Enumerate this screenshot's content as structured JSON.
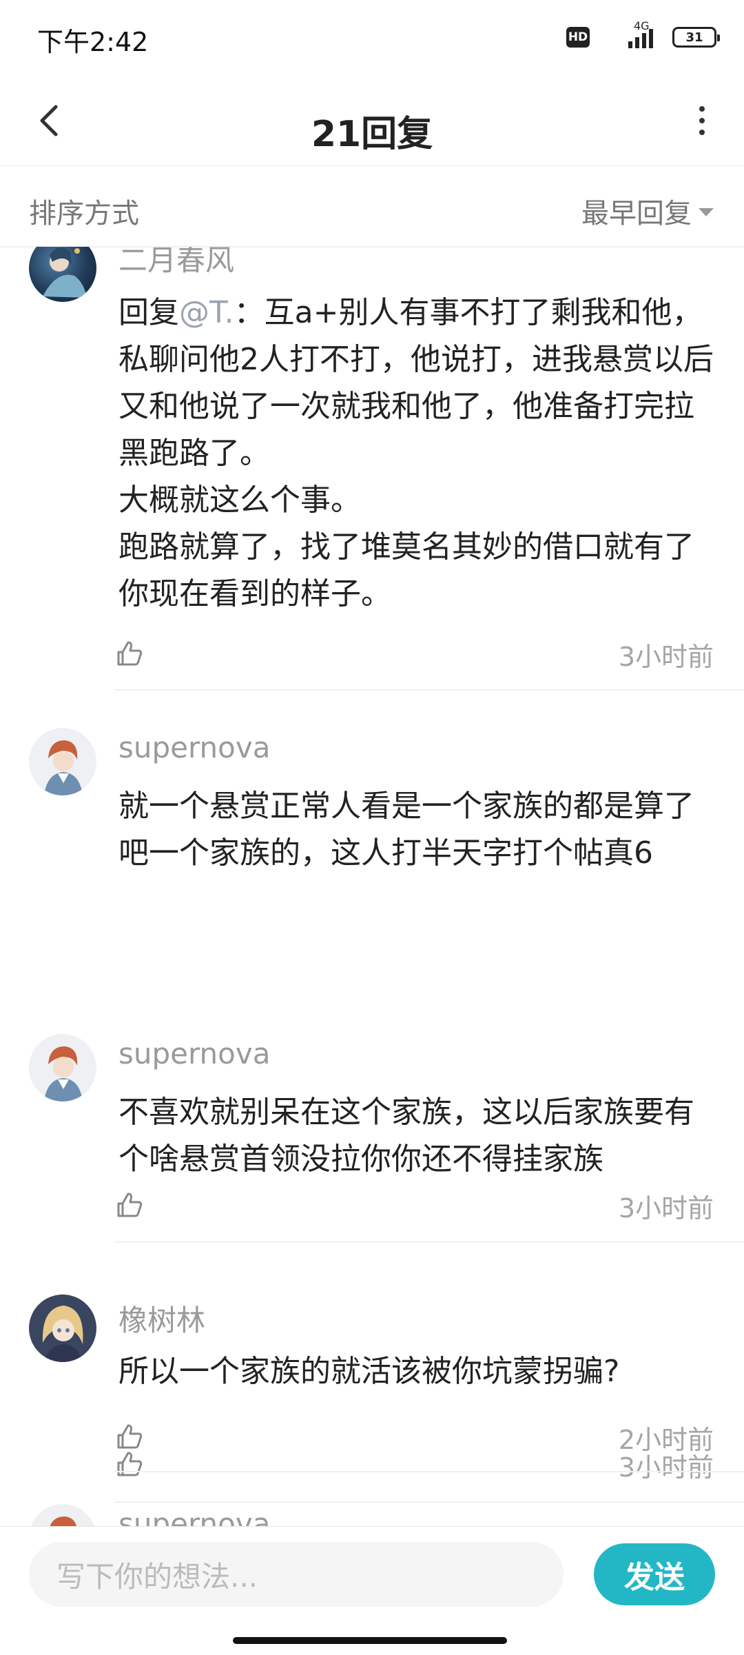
{
  "status_bar": {
    "time": "下午2:42",
    "hd": "HD",
    "network": "4G",
    "battery": "31"
  },
  "header": {
    "title": "21回复",
    "back_icon": "chevron-left-icon",
    "more_icon": "more-vertical-icon"
  },
  "sort": {
    "label": "排序方式",
    "selected": "最早回复"
  },
  "comments": [
    {
      "user": "二月春风",
      "reply_prefix": "回复",
      "mention": "@T.",
      "text": "：互a+别人有事不打了剩我和他，私聊问他2人打不打，他说打，进我悬赏以后又和他说了一次就我和他了，他准备打完拉黑跑路了。\n大概就这么个事。\n跑路就算了，找了堆莫名其妙的借口就有了你现在看到的样子。",
      "time": "3小时前"
    },
    {
      "user": "supernova",
      "text": "就一个悬赏正常人看是一个家族的都是算了吧一个家族的，这人打半天字打个帖真6",
      "time": "3小时前"
    },
    {
      "user": "supernova",
      "text": "不喜欢就别呆在这个家族，这以后家族要有个啥悬赏首领没拉你你还不得挂家族",
      "time": "3小时前"
    },
    {
      "user": "橡树林",
      "text": "所以一个家族的就活该被你坑蒙拐骗?",
      "time": "2小时前"
    },
    {
      "user": "supernova"
    }
  ],
  "input": {
    "placeholder": "写下你的想法...",
    "send_label": "发送"
  },
  "colors": {
    "accent": "#23b7c6",
    "muted_text": "#9a9a9a"
  }
}
